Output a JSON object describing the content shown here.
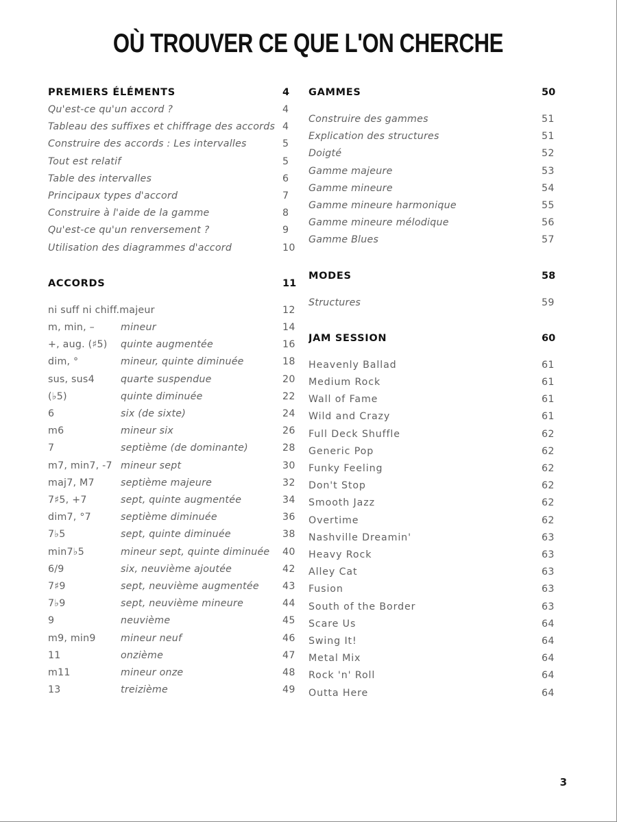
{
  "page": {
    "title": "OÙ TROUVER CE QUE L'ON CHERCHE",
    "folio": "3"
  },
  "left_column": {
    "section_premiers": {
      "heading": "PREMIERS ÉLÉMENTS",
      "page": "4",
      "entries": [
        {
          "label": "Qu'est-ce qu'un accord ?",
          "page": "4"
        },
        {
          "label": "Tableau des suffixes et chiffrage des accords",
          "page": "4"
        },
        {
          "label": "Construire des accords : Les intervalles",
          "page": "5"
        },
        {
          "label": "Tout est relatif",
          "page": "5"
        },
        {
          "label": "Table des intervalles",
          "page": "6"
        },
        {
          "label": "Principaux types d'accord",
          "page": "7"
        },
        {
          "label": "Construire à l'aide de la gamme",
          "page": "8"
        },
        {
          "label": "Qu'est-ce qu'un renversement ?",
          "page": "9"
        },
        {
          "label": "Utilisation des diagrammes d'accord",
          "page": "10"
        }
      ]
    },
    "section_accords": {
      "heading": "ACCORDS",
      "page": "11",
      "entries": [
        {
          "symbol": "ni suff ni chiff.majeur",
          "name": "",
          "page": "12"
        },
        {
          "symbol": "m, min, –",
          "name": "mineur",
          "page": "14"
        },
        {
          "symbol": "+, aug. (♯5)",
          "name": "quinte augmentée",
          "page": "16"
        },
        {
          "symbol": "dim, °",
          "name": "mineur, quinte diminuée",
          "page": "18"
        },
        {
          "symbol": "sus, sus4",
          "name": "quarte suspendue",
          "page": "20"
        },
        {
          "symbol": "(♭5)",
          "name": "quinte diminuée",
          "page": "22"
        },
        {
          "symbol": "6",
          "name": "six (de sixte)",
          "page": "24"
        },
        {
          "symbol": "m6",
          "name": "mineur six",
          "page": "26"
        },
        {
          "symbol": "7",
          "name": "septième (de dominante)",
          "page": "28"
        },
        {
          "symbol": "m7, min7, -7",
          "name": "mineur sept",
          "page": "30"
        },
        {
          "symbol": "maj7, M7",
          "name": "septième majeure",
          "page": "32"
        },
        {
          "symbol": "7♯5, +7",
          "name": "sept, quinte augmentée",
          "page": "34"
        },
        {
          "symbol": "dim7, °7",
          "name": "septième diminuée",
          "page": "36"
        },
        {
          "symbol": "7♭5",
          "name": "sept, quinte diminuée",
          "page": "38"
        },
        {
          "symbol": "min7♭5",
          "name": "mineur sept, quinte diminuée",
          "page": "40"
        },
        {
          "symbol": "6/9",
          "name": "six, neuvième ajoutée",
          "page": "42"
        },
        {
          "symbol": "7♯9",
          "name": "sept, neuvième augmentée",
          "page": "43"
        },
        {
          "symbol": "7♭9",
          "name": "sept, neuvième mineure",
          "page": "44"
        },
        {
          "symbol": "9",
          "name": "neuvième",
          "page": "45"
        },
        {
          "symbol": "m9, min9",
          "name": "mineur neuf",
          "page": "46"
        },
        {
          "symbol": "11",
          "name": "onzième",
          "page": "47"
        },
        {
          "symbol": "m11",
          "name": "mineur onze",
          "page": "48"
        },
        {
          "symbol": "13",
          "name": "treizième",
          "page": "49"
        }
      ]
    }
  },
  "right_column": {
    "section_gammes": {
      "heading": "GAMMES",
      "page": "50",
      "entries": [
        {
          "label": "Construire des gammes",
          "page": "51"
        },
        {
          "label": "Explication des structures",
          "page": "51"
        },
        {
          "label": "Doigté",
          "page": "52"
        },
        {
          "label": "Gamme majeure",
          "page": "53"
        },
        {
          "label": "Gamme mineure",
          "page": "54"
        },
        {
          "label": "Gamme mineure harmonique",
          "page": "55"
        },
        {
          "label": "Gamme mineure mélodique",
          "page": "56"
        },
        {
          "label": "Gamme Blues",
          "page": "57"
        }
      ]
    },
    "section_modes": {
      "heading": "MODES",
      "page": "58",
      "entries": [
        {
          "label": "Structures",
          "page": "59"
        }
      ]
    },
    "section_jam": {
      "heading": "JAM SESSION",
      "page": "60",
      "entries": [
        {
          "label": "Heavenly Ballad",
          "page": "61"
        },
        {
          "label": "Medium Rock",
          "page": "61"
        },
        {
          "label": "Wall of Fame",
          "page": "61"
        },
        {
          "label": "Wild and Crazy",
          "page": "61"
        },
        {
          "label": "Full Deck Shuffle",
          "page": "62"
        },
        {
          "label": "Generic Pop",
          "page": "62"
        },
        {
          "label": "Funky Feeling",
          "page": "62"
        },
        {
          "label": "Don't Stop",
          "page": "62"
        },
        {
          "label": "Smooth Jazz",
          "page": "62"
        },
        {
          "label": "Overtime",
          "page": "62"
        },
        {
          "label": "Nashville Dreamin'",
          "page": "63"
        },
        {
          "label": "Heavy Rock",
          "page": "63"
        },
        {
          "label": "Alley Cat",
          "page": "63"
        },
        {
          "label": "Fusion",
          "page": "63"
        },
        {
          "label": "South of the Border",
          "page": "63"
        },
        {
          "label": "Scare Us",
          "page": "64"
        },
        {
          "label": "Swing It!",
          "page": "64"
        },
        {
          "label": "Metal Mix",
          "page": "64"
        },
        {
          "label": "Rock 'n' Roll",
          "page": "64"
        },
        {
          "label": "Outta Here",
          "page": "64"
        }
      ]
    }
  }
}
